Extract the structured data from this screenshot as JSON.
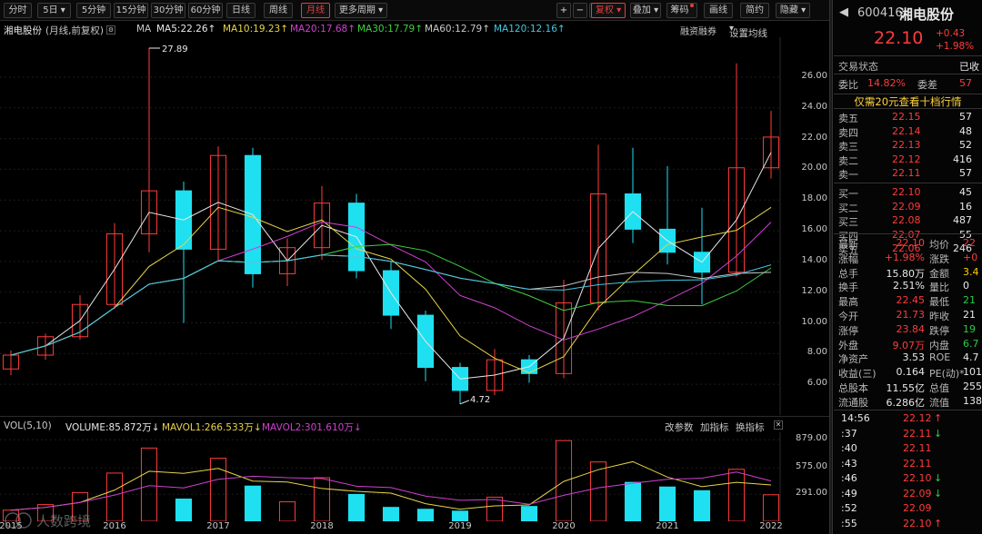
{
  "toolbar": {
    "left_buttons": [
      "分时",
      "5日",
      "5分钟",
      "15分钟",
      "30分钟",
      "60分钟",
      "日线",
      "周线",
      "月线",
      "更多周期"
    ],
    "active": "月线",
    "icon_plus": "+",
    "icon_minus": "−",
    "icon_box": "□",
    "fq_button": "复权",
    "overlay_button": "叠加",
    "chip_button": "筹码",
    "draw_button": "画线",
    "simple_button": "简约",
    "hide_button": "隐藏"
  },
  "chart_header": {
    "name": "湘电股份",
    "mode": "(月线,前复权)",
    "ma_label": "MA",
    "ma": [
      {
        "text": "MA5:22.26↑",
        "color": "#e8e8e8"
      },
      {
        "text": "MA10:19.23↑",
        "color": "#e8d44a"
      },
      {
        "text": "MA20:17.68↑",
        "color": "#d040d0"
      },
      {
        "text": "MA30:17.79↑",
        "color": "#40d040"
      },
      {
        "text": "MA60:12.79↑",
        "color": "#c8c8c8"
      },
      {
        "text": "MA120:12.16↑",
        "color": "#40c8e0"
      }
    ],
    "margin_btn": "融资融券",
    "set_ma_btn": "设置均线"
  },
  "chart_data": {
    "type": "candlestick",
    "x_labels": [
      "2015",
      "2016",
      "2017",
      "2018",
      "2019",
      "2020",
      "2021",
      "2022"
    ],
    "y_axis_price": [
      26.0,
      24.0,
      22.0,
      20.0,
      18.0,
      16.0,
      14.0,
      12.0,
      10.0,
      8.0,
      6.0
    ],
    "annotations": {
      "high": "27.89",
      "low": "4.72"
    },
    "up_color": "#ff3b3b",
    "down_color": "#1ee0f0",
    "candles": [
      {
        "o": 7.0,
        "h": 8.2,
        "l": 6.6,
        "c": 7.9
      },
      {
        "o": 7.9,
        "h": 9.3,
        "l": 7.6,
        "c": 9.1
      },
      {
        "o": 9.1,
        "h": 11.8,
        "l": 8.9,
        "c": 11.2
      },
      {
        "o": 11.2,
        "h": 16.5,
        "l": 10.9,
        "c": 15.8
      },
      {
        "o": 15.8,
        "h": 27.89,
        "l": 14.6,
        "c": 18.6
      },
      {
        "o": 18.6,
        "h": 19.2,
        "l": 10.0,
        "c": 14.8
      },
      {
        "o": 14.8,
        "h": 21.5,
        "l": 14.0,
        "c": 20.9
      },
      {
        "o": 20.9,
        "h": 21.4,
        "l": 12.3,
        "c": 13.2
      },
      {
        "o": 13.2,
        "h": 15.5,
        "l": 12.4,
        "c": 14.9
      },
      {
        "o": 14.9,
        "h": 18.9,
        "l": 14.1,
        "c": 17.8
      },
      {
        "o": 17.8,
        "h": 18.4,
        "l": 12.9,
        "c": 13.4
      },
      {
        "o": 13.4,
        "h": 14.0,
        "l": 9.6,
        "c": 10.5
      },
      {
        "o": 10.5,
        "h": 10.8,
        "l": 6.2,
        "c": 7.1
      },
      {
        "o": 7.1,
        "h": 7.4,
        "l": 4.72,
        "c": 5.6
      },
      {
        "o": 5.6,
        "h": 8.3,
        "l": 5.3,
        "c": 7.6
      },
      {
        "o": 7.6,
        "h": 7.9,
        "l": 6.1,
        "c": 6.7
      },
      {
        "o": 6.7,
        "h": 12.8,
        "l": 6.4,
        "c": 11.3
      },
      {
        "o": 11.3,
        "h": 21.6,
        "l": 10.8,
        "c": 18.4
      },
      {
        "o": 18.4,
        "h": 21.4,
        "l": 15.2,
        "c": 16.1
      },
      {
        "o": 16.1,
        "h": 20.2,
        "l": 13.8,
        "c": 14.6
      },
      {
        "o": 14.6,
        "h": 17.5,
        "l": 11.2,
        "c": 13.3
      },
      {
        "o": 13.3,
        "h": 26.9,
        "l": 13.0,
        "c": 20.1
      },
      {
        "o": 20.1,
        "h": 23.8,
        "l": 19.4,
        "c": 22.1
      }
    ]
  },
  "volume": {
    "header_label": "VOL(5,10)",
    "volume_text": "VOLUME:85.872万↓",
    "mavol1_text": "MAVOL1:266.533万↓",
    "mavol2_text": "MAVOL2:301.610万↓",
    "change_param": "改参数",
    "add_indicator": "加指标",
    "switch_indicator": "换指标",
    "y_labels": [
      "879.00",
      "575.00",
      "291.00"
    ],
    "bars_up_color": "#ff3b3b",
    "bars_down_color": "#1ee0f0",
    "values": [
      120,
      180,
      310,
      520,
      790,
      240,
      680,
      380,
      210,
      470,
      290,
      150,
      130,
      110,
      260,
      160,
      870,
      640,
      420,
      370,
      330,
      560,
      286
    ]
  },
  "watermark": "人数跨境",
  "info": {
    "back_arrow": "◀",
    "code": "600416",
    "name": "湘电股份",
    "price": "22.10",
    "change": "+0.43",
    "change_pct": "+1.98%",
    "status_label": "交易状态",
    "status_value": "已收",
    "weibi_label": "委比",
    "weibi_value": "14.82%",
    "weicha_label": "委差",
    "weicha_value": "57",
    "banner": "仅需20元查看十档行情",
    "asks": [
      {
        "label": "卖五",
        "price": "22.15",
        "vol": "57"
      },
      {
        "label": "卖四",
        "price": "22.14",
        "vol": "48"
      },
      {
        "label": "卖三",
        "price": "22.13",
        "vol": "52"
      },
      {
        "label": "卖二",
        "price": "22.12",
        "vol": "416"
      },
      {
        "label": "卖一",
        "price": "22.11",
        "vol": "57"
      }
    ],
    "bids": [
      {
        "label": "买一",
        "price": "22.10",
        "vol": "45"
      },
      {
        "label": "买二",
        "price": "22.09",
        "vol": "16"
      },
      {
        "label": "买三",
        "price": "22.08",
        "vol": "487"
      },
      {
        "label": "买四",
        "price": "22.07",
        "vol": "55"
      },
      {
        "label": "买五",
        "price": "22.06",
        "vol": "246"
      }
    ],
    "stats": [
      {
        "l1": "最新",
        "v1": "22.10",
        "c1": "red",
        "l2": "均价",
        "v2": "22",
        "c2": "red"
      },
      {
        "l1": "涨幅",
        "v1": "+1.98%",
        "c1": "red",
        "l2": "涨跌",
        "v2": "+0",
        "c2": "red"
      },
      {
        "l1": "总手",
        "v1": "15.80万",
        "c1": "white",
        "l2": "金额",
        "v2": "3.4",
        "c2": "yellow"
      },
      {
        "l1": "换手",
        "v1": "2.51%",
        "c1": "white",
        "l2": "量比",
        "v2": "0",
        "c2": "white"
      },
      {
        "l1": "最高",
        "v1": "22.45",
        "c1": "red",
        "l2": "最低",
        "v2": "21",
        "c2": "green"
      },
      {
        "l1": "今开",
        "v1": "21.73",
        "c1": "red",
        "l2": "昨收",
        "v2": "21",
        "c2": "white"
      },
      {
        "l1": "涨停",
        "v1": "23.84",
        "c1": "red",
        "l2": "跌停",
        "v2": "19",
        "c2": "green"
      },
      {
        "l1": "外盘",
        "v1": "9.07万",
        "c1": "red",
        "l2": "内盘",
        "v2": "6.7",
        "c2": "green"
      },
      {
        "l1": "净资产",
        "v1": "3.53",
        "c1": "white",
        "l2": "ROE",
        "v2": "4.7",
        "c2": "white"
      },
      {
        "l1": "收益(三)",
        "v1": "0.164",
        "c1": "white",
        "l2": "PE(动)*",
        "v2": "101",
        "c2": "white"
      },
      {
        "l1": "总股本",
        "v1": "11.55亿",
        "c1": "white",
        "l2": "总值",
        "v2": "255.",
        "c2": "white"
      },
      {
        "l1": "流通股",
        "v1": "6.286亿",
        "c1": "white",
        "l2": "流值",
        "v2": "138.",
        "c2": "white"
      }
    ],
    "ticks": [
      {
        "time": "14:56",
        "price": "22.12",
        "arrow": "↑",
        "dir": "up"
      },
      {
        "time": ":37",
        "price": "22.11",
        "arrow": "↓",
        "dir": "dn"
      },
      {
        "time": ":40",
        "price": "22.11",
        "arrow": "",
        "dir": ""
      },
      {
        "time": ":43",
        "price": "22.11",
        "arrow": "",
        "dir": ""
      },
      {
        "time": ":46",
        "price": "22.10",
        "arrow": "↓",
        "dir": "dn"
      },
      {
        "time": ":49",
        "price": "22.09",
        "arrow": "↓",
        "dir": "dn"
      },
      {
        "time": ":52",
        "price": "22.09",
        "arrow": "",
        "dir": ""
      },
      {
        "time": ":55",
        "price": "22.10",
        "arrow": "↑",
        "dir": "up"
      }
    ]
  }
}
